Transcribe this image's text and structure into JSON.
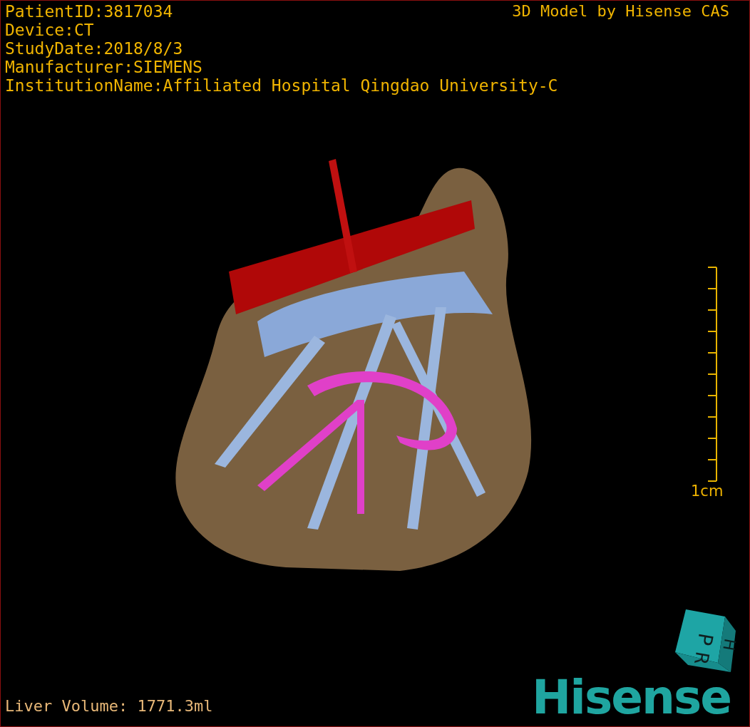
{
  "viewport": {
    "info_lines": [
      "PatientID:3817034",
      "Device:CT",
      "StudyDate:2018/8/3",
      "Manufacturer:SIEMENS",
      "InstitutionName:Affiliated Hospital Qingdao University-C"
    ],
    "credit": "3D Model by Hisense CAS",
    "scale_bar": {
      "label": "1cm"
    },
    "orientation_cube": {
      "faces": [
        "P",
        "R",
        "H"
      ]
    },
    "logo": "Hisense",
    "footer": "Liver Volume: 1771.3ml"
  }
}
